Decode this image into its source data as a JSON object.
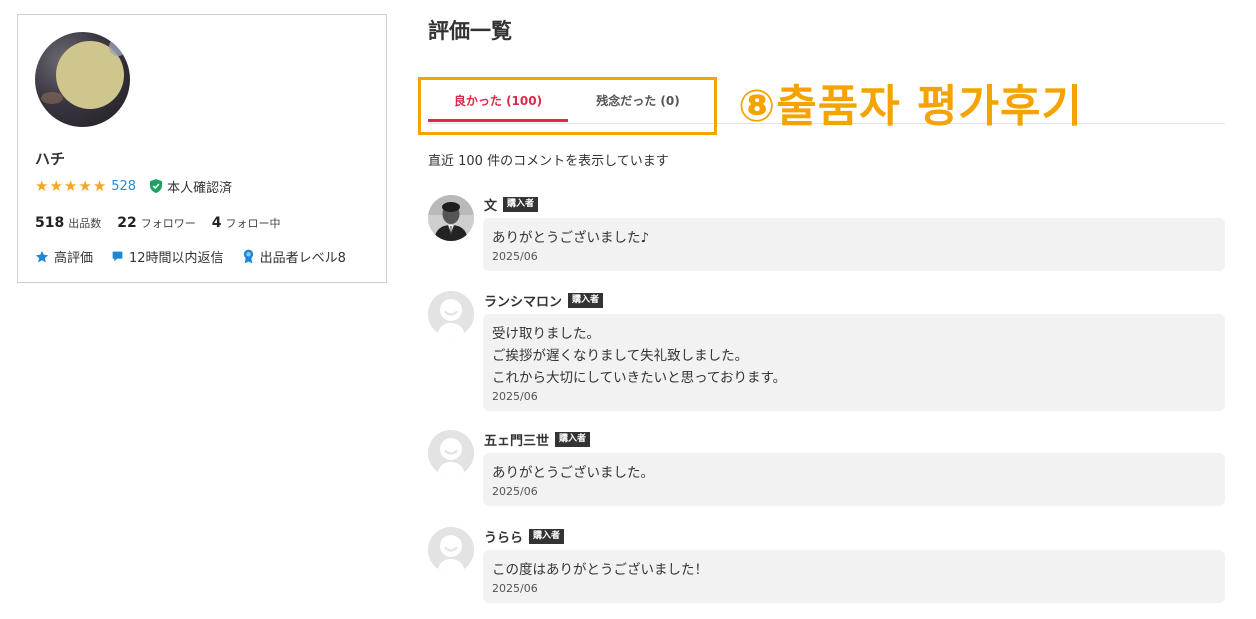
{
  "profile": {
    "name": "ハチ",
    "stars": [
      "★",
      "★",
      "★",
      "★",
      "★"
    ],
    "rating_count": "528",
    "verified_label": "本人確認済",
    "stats": [
      {
        "value": "518",
        "label": "出品数"
      },
      {
        "value": "22",
        "label": "フォロワー"
      },
      {
        "value": "4",
        "label": "フォロー中"
      }
    ],
    "badges": [
      {
        "icon": "star-icon",
        "label": "高評価"
      },
      {
        "icon": "chat-bubble-icon",
        "label": "12時間以内返信"
      },
      {
        "icon": "ribbon-medal-icon",
        "label": "出品者レベル8"
      }
    ]
  },
  "main": {
    "title": "評価一覧",
    "tabs": [
      {
        "label": "良かった (100)",
        "active": true
      },
      {
        "label": "残念だった (0)",
        "active": false
      }
    ],
    "annotation": "⑧출품자 평가후기",
    "notice": "直近 100 件のコメントを表示しています",
    "buyer_tag": "購入者",
    "reviews": [
      {
        "name": "文",
        "avatar": "photo-avatar",
        "text": "ありがとうございました♪",
        "date": "2025/06"
      },
      {
        "name": "ランシマロン",
        "avatar": "default-avatar",
        "text": "受け取りました。\nご挨拶が遅くなりまして失礼致しました。\nこれから大切にしていきたいと思っております。",
        "date": "2025/06"
      },
      {
        "name": "五ェ門三世",
        "avatar": "default-avatar",
        "text": "ありがとうございました。",
        "date": "2025/06"
      },
      {
        "name": "うらら",
        "avatar": "default-avatar",
        "text": "この度はありがとうございました！",
        "date": "2025/06"
      }
    ]
  },
  "colors": {
    "accent_red": "#e0284b",
    "star_gold": "#f5a623",
    "link_blue": "#2a8bd0",
    "annotation_orange": "#f5a300",
    "verified_green": "#1aa260"
  }
}
